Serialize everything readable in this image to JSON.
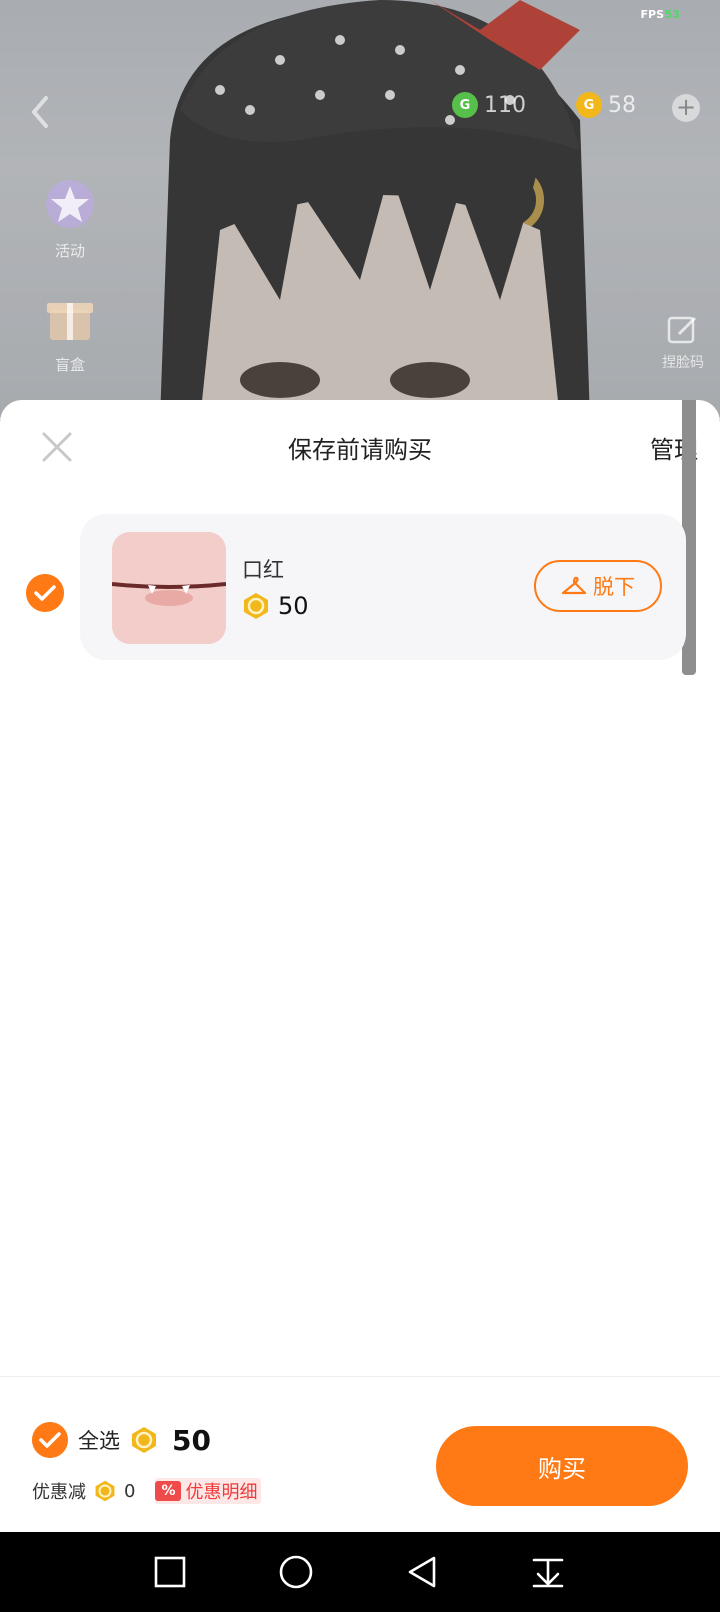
{
  "status": {
    "fps_label": "FPS",
    "fps_value": "53"
  },
  "scene": {
    "currency_g": {
      "icon": "g-coin-icon",
      "value": "110",
      "color": "#57c04a"
    },
    "currency_coin": {
      "icon": "gold-coin-icon",
      "value": "58",
      "color": "#f2b71a"
    },
    "side_buttons": [
      {
        "label": "活动",
        "icon": "star-badge-icon"
      },
      {
        "label": "盲盒",
        "icon": "gift-box-icon"
      }
    ],
    "right_button": {
      "label": "捏脸码",
      "icon": "edit-icon"
    }
  },
  "sheet": {
    "title": "保存前请购买",
    "manage_label": "管理",
    "items": [
      {
        "name": "口红",
        "price": "50",
        "checked": true,
        "take_off_label": "脱下"
      }
    ]
  },
  "footer": {
    "select_all_label": "全选",
    "total": "50",
    "discount_label": "优惠减",
    "discount_value": "0",
    "discount_pct": "%",
    "discount_detail_label": "优惠明细",
    "buy_label": "购买"
  },
  "colors": {
    "accent": "#ff7a14",
    "discount": "#f03b3b",
    "coin": "#f2b71a"
  }
}
